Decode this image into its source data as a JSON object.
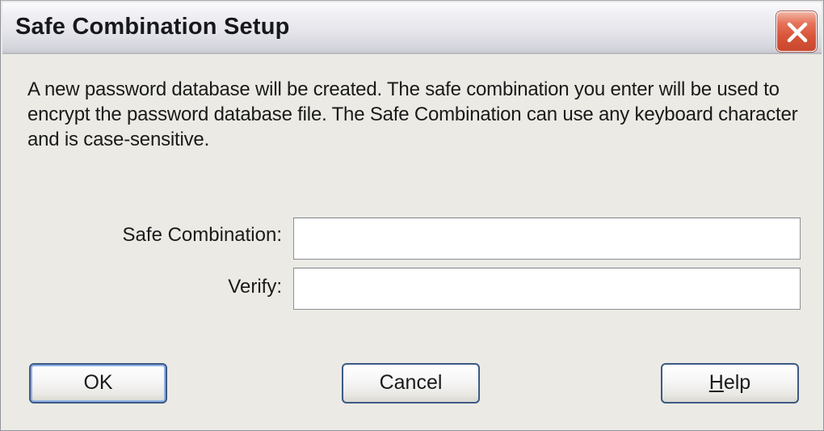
{
  "window": {
    "title": "Safe Combination Setup"
  },
  "description": "A new password database will be created. The safe combination you enter will be used to encrypt the password database file. The Safe Combination can use any keyboard character and is case-sensitive.",
  "form": {
    "safe_combination_label": "Safe Combination:",
    "safe_combination_value": "",
    "verify_label": "Verify:",
    "verify_value": ""
  },
  "buttons": {
    "ok_label": "OK",
    "cancel_label": "Cancel",
    "help_label_first": "H",
    "help_label_rest": "elp"
  },
  "icons": {
    "close": "close-icon"
  },
  "colors": {
    "close_button": "#d8553a",
    "default_button_border": "#3d5a85",
    "dialog_background": "#ebeae4"
  }
}
